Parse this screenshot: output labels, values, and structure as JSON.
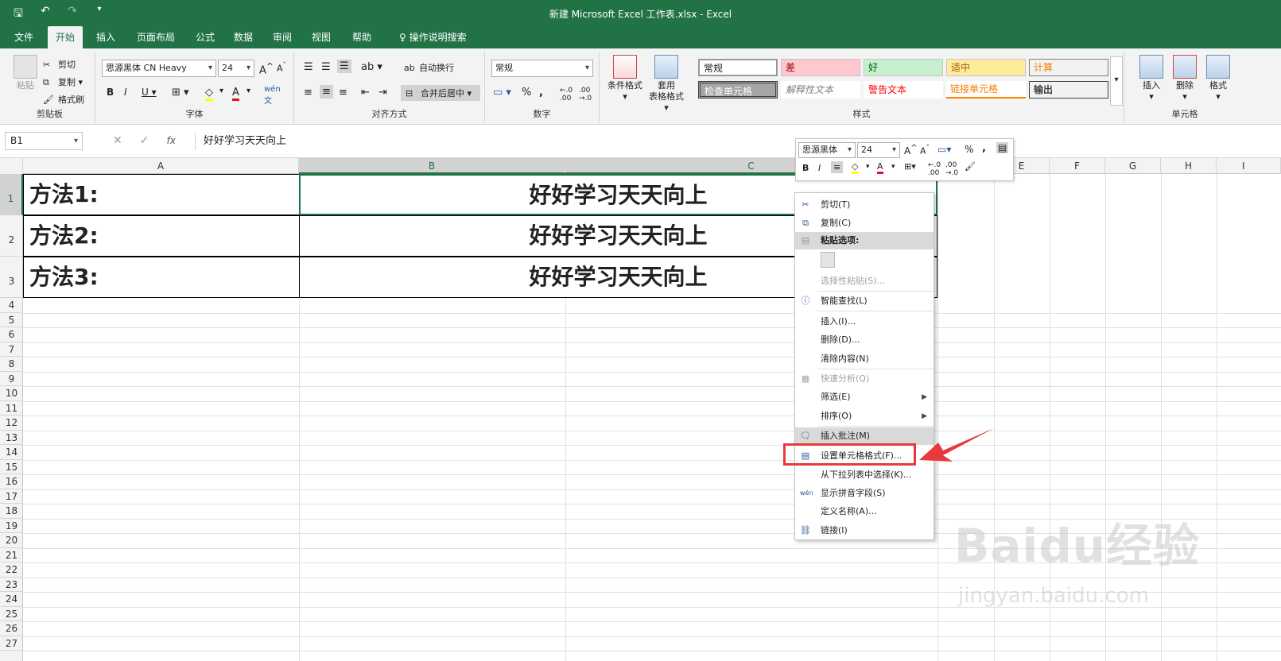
{
  "window": {
    "title": "新建 Microsoft Excel 工作表.xlsx  -  Excel"
  },
  "tabs": [
    {
      "label": "文件"
    },
    {
      "label": "开始"
    },
    {
      "label": "插入"
    },
    {
      "label": "页面布局"
    },
    {
      "label": "公式"
    },
    {
      "label": "数据"
    },
    {
      "label": "审阅"
    },
    {
      "label": "视图"
    },
    {
      "label": "帮助"
    },
    {
      "label": "操作说明搜索"
    }
  ],
  "ribbon": {
    "clipboard": {
      "label": "剪贴板",
      "paste": "粘贴",
      "cut": "剪切",
      "copy": "复制",
      "format_painter": "格式刷"
    },
    "font": {
      "label": "字体",
      "name": "思源黑体 CN Heavy",
      "size": "24"
    },
    "alignment": {
      "label": "对齐方式",
      "wrap": "自动换行",
      "merge": "合并后居中"
    },
    "number": {
      "label": "数字",
      "format": "常规"
    },
    "styles": {
      "label": "样式",
      "cond_format": "条件格式",
      "table_format_1": "套用",
      "table_format_2": "表格格式",
      "items": [
        "常规",
        "差",
        "好",
        "适中",
        "计算",
        "检查单元格",
        "解释性文本",
        "警告文本",
        "链接单元格",
        "输出"
      ]
    },
    "cells": {
      "label": "单元格",
      "insert": "插入",
      "delete": "删除",
      "format": "格式"
    }
  },
  "formula_bar": {
    "name_box": "B1",
    "fx": "fx",
    "value": "好好学习天天向上"
  },
  "columns": [
    "A",
    "B",
    "C",
    "E",
    "F",
    "G",
    "H",
    "I"
  ],
  "rows": [
    "1",
    "2",
    "3",
    "4",
    "5",
    "6",
    "7",
    "8",
    "9",
    "10",
    "11",
    "12",
    "13",
    "14",
    "15",
    "16",
    "17",
    "18",
    "19",
    "20",
    "21",
    "22",
    "23",
    "24",
    "25",
    "26",
    "27"
  ],
  "cells": [
    {
      "a": "方法1:",
      "b": "好好学习天天向上"
    },
    {
      "a": "方法2:",
      "b": "好好学习天天向上"
    },
    {
      "a": "方法3:",
      "b": "好好学习天天向上"
    }
  ],
  "mini_toolbar": {
    "font": "思源黑体",
    "size": "24"
  },
  "context_menu": {
    "cut": "剪切(T)",
    "copy": "复制(C)",
    "paste_options": "粘贴选项:",
    "paste_special": "选择性粘贴(S)...",
    "smart_lookup": "智能查找(L)",
    "insert": "插入(I)...",
    "delete": "删除(D)...",
    "clear": "清除内容(N)",
    "quick_analysis": "快速分析(Q)",
    "filter": "筛选(E)",
    "sort": "排序(O)",
    "insert_comment": "插入批注(M)",
    "format_cells": "设置单元格格式(F)...",
    "pick_list": "从下拉列表中选择(K)...",
    "phonetic": "显示拼音字段(S)",
    "define_name": "定义名称(A)...",
    "link": "链接(I)"
  },
  "watermark": {
    "line1": "Baidu经验",
    "line2": "jingyan.baidu.com"
  }
}
